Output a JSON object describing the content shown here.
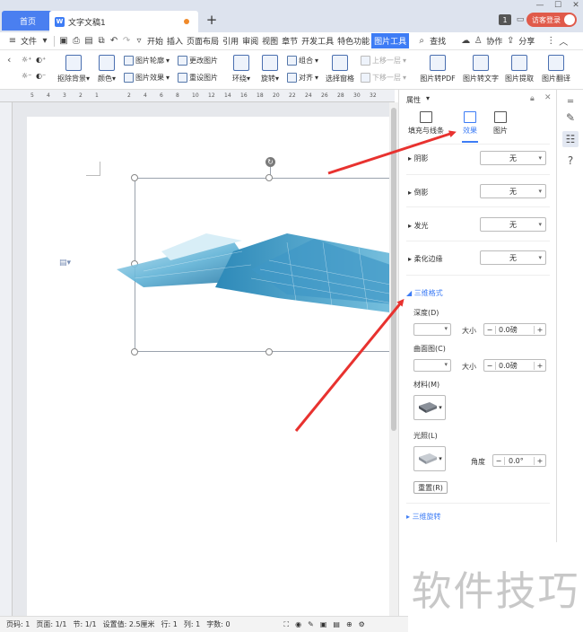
{
  "titlebar": {
    "home_tab": "首页",
    "doc_tab": "文字文稿1",
    "doc_icon": "W",
    "new_tab": "+",
    "window_count": "1",
    "login": "访客登录"
  },
  "menubar": {
    "file": "文件",
    "items": [
      "开始",
      "插入",
      "页面布局",
      "引用",
      "审阅",
      "视图",
      "章节",
      "开发工具",
      "特色功能"
    ],
    "active_tab": "图片工具",
    "search": "查找",
    "collab": "协作",
    "share": "分享"
  },
  "ribbon": {
    "remove_bg": "抠除背景",
    "color": "颜色",
    "outline": "图片轮廓",
    "effect": "图片效果",
    "change": "更改图片",
    "reset": "重设图片",
    "wrap": "环绕",
    "rotate": "旋转",
    "group": "组合",
    "align": "对齐",
    "select_pane": "选择窗格",
    "bring_forward": "上移一层",
    "send_backward": "下移一层",
    "to_pdf": "图片转PDF",
    "to_text": "图片转文字",
    "extract": "图片提取",
    "translate": "图片翻译"
  },
  "ruler": {
    "ticks": [
      "5",
      "4",
      "3",
      "2",
      "1",
      "",
      "2",
      "4",
      "6",
      "8",
      "10",
      "12",
      "14",
      "16",
      "18",
      "20",
      "22",
      "24",
      "26",
      "28",
      "30",
      "32"
    ]
  },
  "panel": {
    "title": "属性",
    "tabs": [
      "填充与线条",
      "效果",
      "图片"
    ],
    "active_tab": "效果",
    "rows": [
      {
        "label": "阴影",
        "value": "无"
      },
      {
        "label": "倒影",
        "value": "无"
      },
      {
        "label": "发光",
        "value": "无"
      },
      {
        "label": "柔化边缘",
        "value": "无"
      }
    ],
    "section_3d": "三维格式",
    "depth": "深度(D)",
    "size": "大小",
    "depth_value": "0.0磅",
    "bevel": "曲面图(C)",
    "bevel_value": "0.0磅",
    "material": "材料(M)",
    "lighting": "光照(L)",
    "angle": "角度",
    "angle_value": "0.0°",
    "reset_btn": "重置(R)",
    "section_rotation": "三维旋转"
  },
  "status": {
    "page_code": "页码: 1",
    "pages": "页面: 1/1",
    "section": "节: 1/1",
    "setting": "设置值: 2.5厘米",
    "row": "行: 1",
    "col": "列: 1",
    "words": "字数: 0"
  },
  "watermark": "软件技巧",
  "colors": {
    "accent": "#3d7cf5",
    "arrow": "#e8322f",
    "login": "#e05a4a"
  }
}
